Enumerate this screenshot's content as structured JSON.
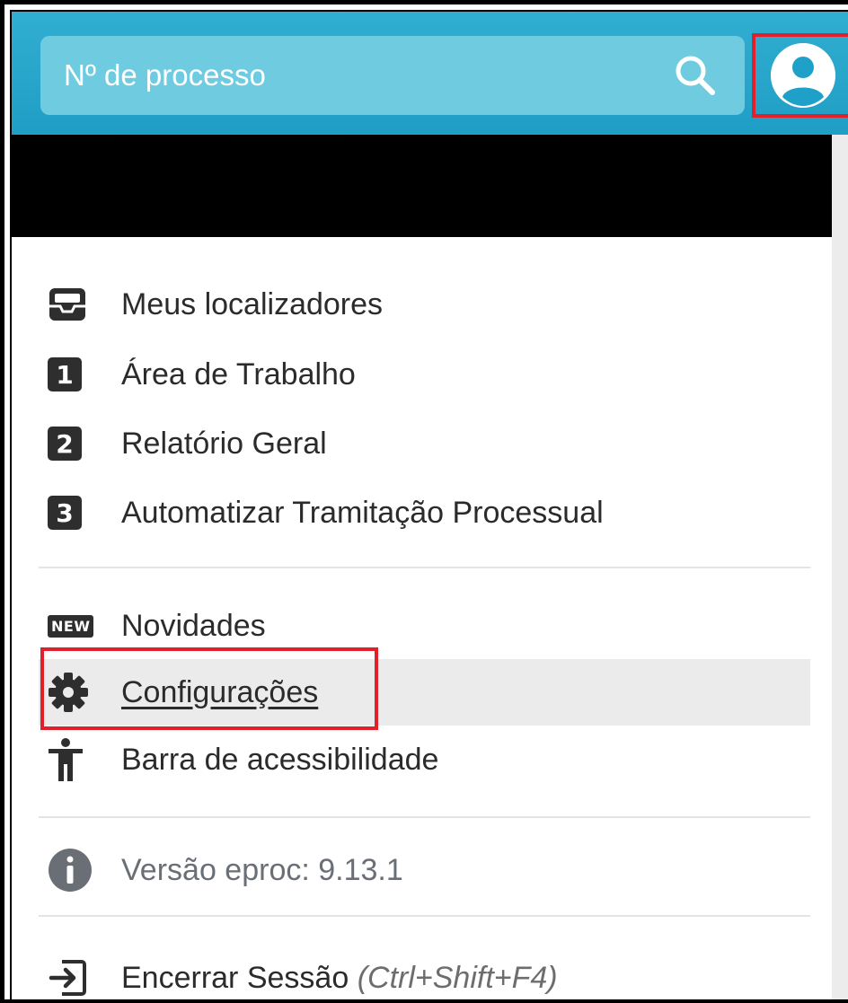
{
  "header": {
    "search_placeholder": "Nº de processo",
    "search_icon": "search-icon",
    "avatar_icon": "user-circle-icon",
    "accent": "#1fa0c8"
  },
  "menu": {
    "items": [
      {
        "label": "Meus localizadores",
        "icon": "inbox-tray-icon"
      },
      {
        "label": "Área de Trabalho",
        "icon": "number-1-icon",
        "glyph": "1"
      },
      {
        "label": "Relatório Geral",
        "icon": "number-2-icon",
        "glyph": "2"
      },
      {
        "label": "Automatizar Tramitação Processual",
        "icon": "number-3-icon",
        "glyph": "3"
      },
      {
        "label": "Novidades",
        "icon": "new-badge-icon",
        "glyph": "NEW"
      },
      {
        "label": "Configurações",
        "icon": "gear-icon",
        "active": true
      },
      {
        "label": "Barra de acessibilidade",
        "icon": "accessibility-person-icon"
      }
    ],
    "version": {
      "label": "Versão eproc: 9.13.1",
      "icon": "info-circle-icon"
    },
    "logout": {
      "label": "Encerrar Sessão",
      "shortcut": "(Ctrl+Shift+F4)",
      "icon": "sign-out-icon"
    }
  },
  "highlight_color": "#e0202a"
}
